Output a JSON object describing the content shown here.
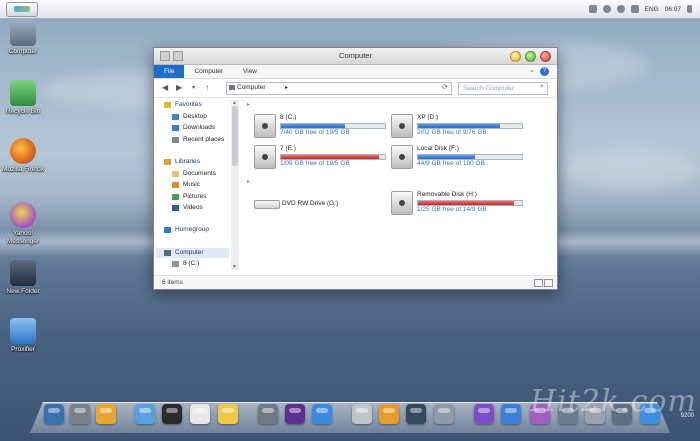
{
  "topbar": {
    "tray_lang": "ENG",
    "tray_time": "06:07"
  },
  "desktop_icons": [
    {
      "label": "Computer",
      "color": "#5b6b7e"
    },
    {
      "label": "Recycle Bin",
      "color": "#3d9b4a"
    },
    {
      "label": "Mozilla Firefox",
      "color": "#e07a1f"
    },
    {
      "label": "Yahoo! Messenger",
      "color": "#7b3aa6"
    },
    {
      "label": "New Folder",
      "color": "#2b3a4e"
    },
    {
      "label": "Proxifier",
      "color": "#2c74c9"
    }
  ],
  "window": {
    "title": "Computer",
    "ribbon_tabs": [
      "File",
      "Computer",
      "View"
    ],
    "address_crumb": "Computer",
    "search_placeholder": "Search Computer",
    "nav_pane": [
      {
        "label": "Favorites",
        "icon": "star-icon",
        "bold": true
      },
      {
        "label": "Desktop",
        "icon": "desktop-icon"
      },
      {
        "label": "Downloads",
        "icon": "downloads-icon"
      },
      {
        "label": "Recent places",
        "icon": "recent-places-icon"
      },
      {
        "label": "Libraries",
        "icon": "libraries-icon",
        "bold": true
      },
      {
        "label": "Documents",
        "icon": "documents-icon"
      },
      {
        "label": "Music",
        "icon": "music-icon"
      },
      {
        "label": "Pictures",
        "icon": "pictures-icon"
      },
      {
        "label": "Videos",
        "icon": "videos-icon"
      },
      {
        "label": "Homegroup",
        "icon": "homegroup-icon",
        "bold": true
      },
      {
        "label": "Computer",
        "icon": "computer-icon",
        "bold": true,
        "selected": true
      },
      {
        "label": "8 (C:)",
        "icon": "drive-icon"
      }
    ],
    "drives": [
      {
        "name": "8 (C:)",
        "free": "7/40 GB free of 19/5 GB",
        "used_fraction": 0.62,
        "state": "normal"
      },
      {
        "name": "XP (D:)",
        "free": "2/02 GB free of 9/76 GB",
        "used_fraction": 0.79,
        "state": "normal"
      },
      {
        "name": "7 (E:)",
        "free": "1/09 GB free of 19/5 GB",
        "used_fraction": 0.94,
        "state": "full"
      },
      {
        "name": "Local Disk (F:)",
        "free": "44/9 GB free of 100 GB",
        "used_fraction": 0.55,
        "state": "normal"
      },
      {
        "name": "Removable Disk (H:)",
        "free": "1/25 GB free of 14/9 GB",
        "used_fraction": 0.92,
        "state": "full"
      }
    ],
    "dvd": {
      "name": "DVD RW Drive (G:)"
    },
    "status": "6 items"
  },
  "dock": {
    "colors": [
      "#3a6fb0",
      "#7a7f86",
      "#e8a530",
      "#5aa0e0",
      "#2b2b2b",
      "#e8e8e8",
      "#f0c84a",
      "#6f7a86",
      "#5b2e8f",
      "#3e8ae0",
      "#c0c5cc",
      "#e89a2a",
      "#34495e",
      "#8e9aa6",
      "#7b4fc8",
      "#3b7fd6",
      "#a25fc2",
      "#6a7d90",
      "#9aa3ad",
      "#5f6f80",
      "#3d8fe0"
    ],
    "build": "9200"
  },
  "watermark": "Hit2k.com"
}
